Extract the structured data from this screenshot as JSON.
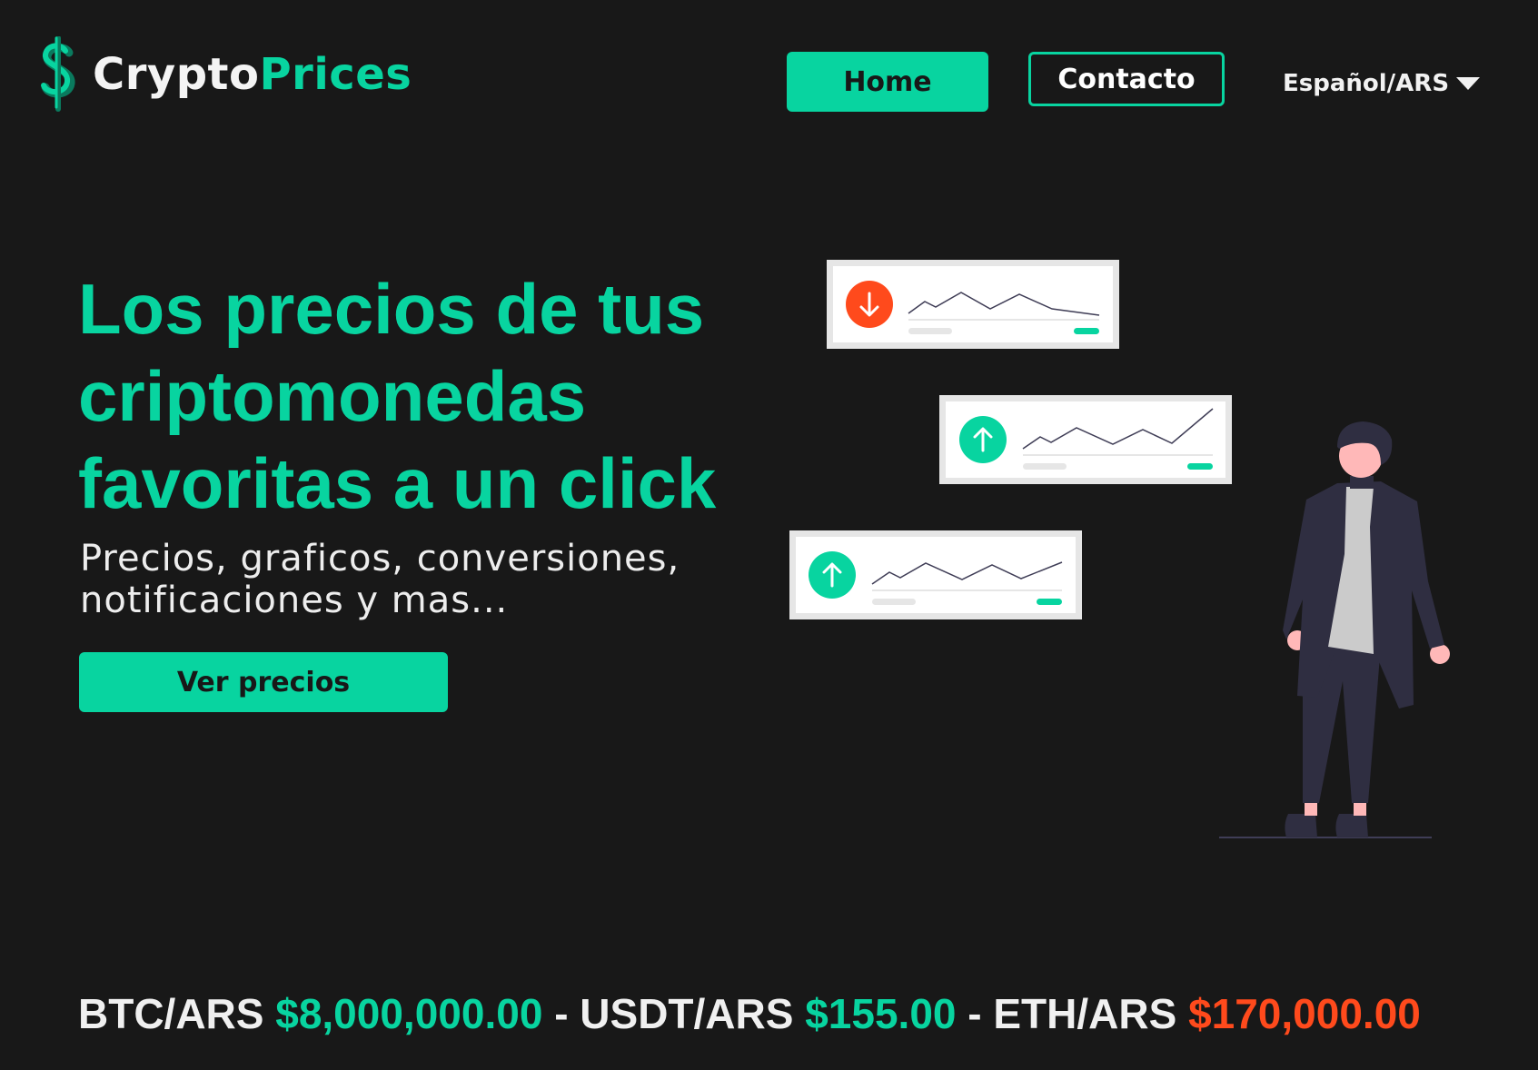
{
  "header": {
    "brand_part1": "Crypto",
    "brand_part2": "Prices",
    "logo_icon": "dollar-sign-icon",
    "nav": {
      "home_label": "Home",
      "contact_label": "Contacto"
    },
    "language_label": "Español/ARS",
    "language_icon": "caret-down-icon"
  },
  "hero": {
    "title_line1": "Los precios de tus",
    "title_line2": "criptomonedas",
    "title_line3": "favoritas a un click",
    "subtitle_line1": "Precios, graficos, conversiones,",
    "subtitle_line2": "notificaciones y mas...",
    "cta_label": "Ver precios"
  },
  "illustration": {
    "cards": [
      {
        "trend": "down",
        "icon": "arrow-down-icon"
      },
      {
        "trend": "up",
        "icon": "arrow-up-icon"
      },
      {
        "trend": "up",
        "icon": "arrow-up-icon"
      }
    ]
  },
  "ticker": {
    "items": [
      {
        "pair": "BTC/ARS",
        "price": "$8,000,000.00",
        "trend": "up"
      },
      {
        "pair": "USDT/ARS",
        "price": "$155.00",
        "trend": "up"
      },
      {
        "pair": "ETH/ARS",
        "price": "$170,000.00",
        "trend": "down"
      }
    ],
    "separator": "-"
  },
  "colors": {
    "background": "#181818",
    "accent": "#08d4a0",
    "down": "#ff4a1c",
    "text": "#ffffff"
  }
}
